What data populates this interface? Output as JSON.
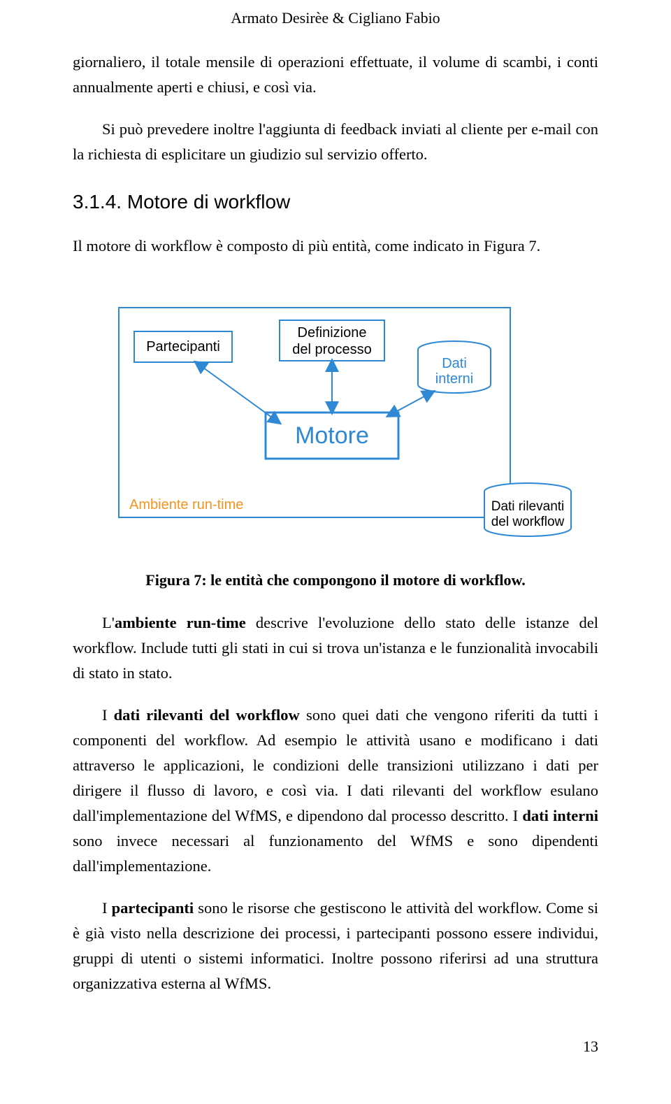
{
  "header": {
    "authors": "Armato Desirèe & Cigliano Fabio"
  },
  "para1_a": "giornaliero, il totale mensile di operazioni effettuate, il volume di scambi, i conti annualmente aperti e chiusi, e così via.",
  "para1_b": "Si può prevedere inoltre l'aggiunta di feedback inviati al cliente per e-mail con la richiesta di esplicitare un giudizio sul servizio offerto.",
  "section": {
    "number": "3.1.4.",
    "title": "Motore di workflow"
  },
  "para2": "Il motore di workflow è composto di più entità, come indicato in Figura 7.",
  "diagram": {
    "participants": "Partecipanti",
    "definition_l1": "Definizione",
    "definition_l2": "del processo",
    "data_internal_l1": "Dati",
    "data_internal_l2": "interni",
    "engine": "Motore",
    "runtime": "Ambiente run-time",
    "ext_data_l1": "Dati rilevanti",
    "ext_data_l2": "del workflow"
  },
  "caption": "Figura 7: le entità che compongono il motore di workflow.",
  "p3": {
    "a": "L'",
    "b": "ambiente run-time",
    "c": " descrive l'evoluzione dello stato delle istanze del workflow. Include tutti gli stati in cui si trova un'istanza e le funzionalità invocabili di stato in stato."
  },
  "p4": {
    "a": "I ",
    "b": "dati rilevanti del workflow",
    "c": " sono quei dati che vengono riferiti da tutti i componenti del workflow. Ad esempio le attività usano e modificano i dati attraverso le applicazioni, le condizioni delle transizioni utilizzano i dati per dirigere il flusso di lavoro, e così via. I dati rilevanti del workflow esulano dall'implementazione del WfMS, e dipendono dal processo descritto. I ",
    "d": "dati interni",
    "e": " sono invece necessari al funzionamento del WfMS e sono dipendenti dall'implementazione."
  },
  "p5": {
    "a": "I ",
    "b": "partecipanti",
    "c": " sono le risorse che gestiscono le attività del workflow. Come si è già visto nella descrizione dei processi, i partecipanti possono essere individui, gruppi di utenti o sistemi informatici. Inoltre possono riferirsi ad una struttura organizzativa esterna al WfMS."
  },
  "pagenum": "13"
}
